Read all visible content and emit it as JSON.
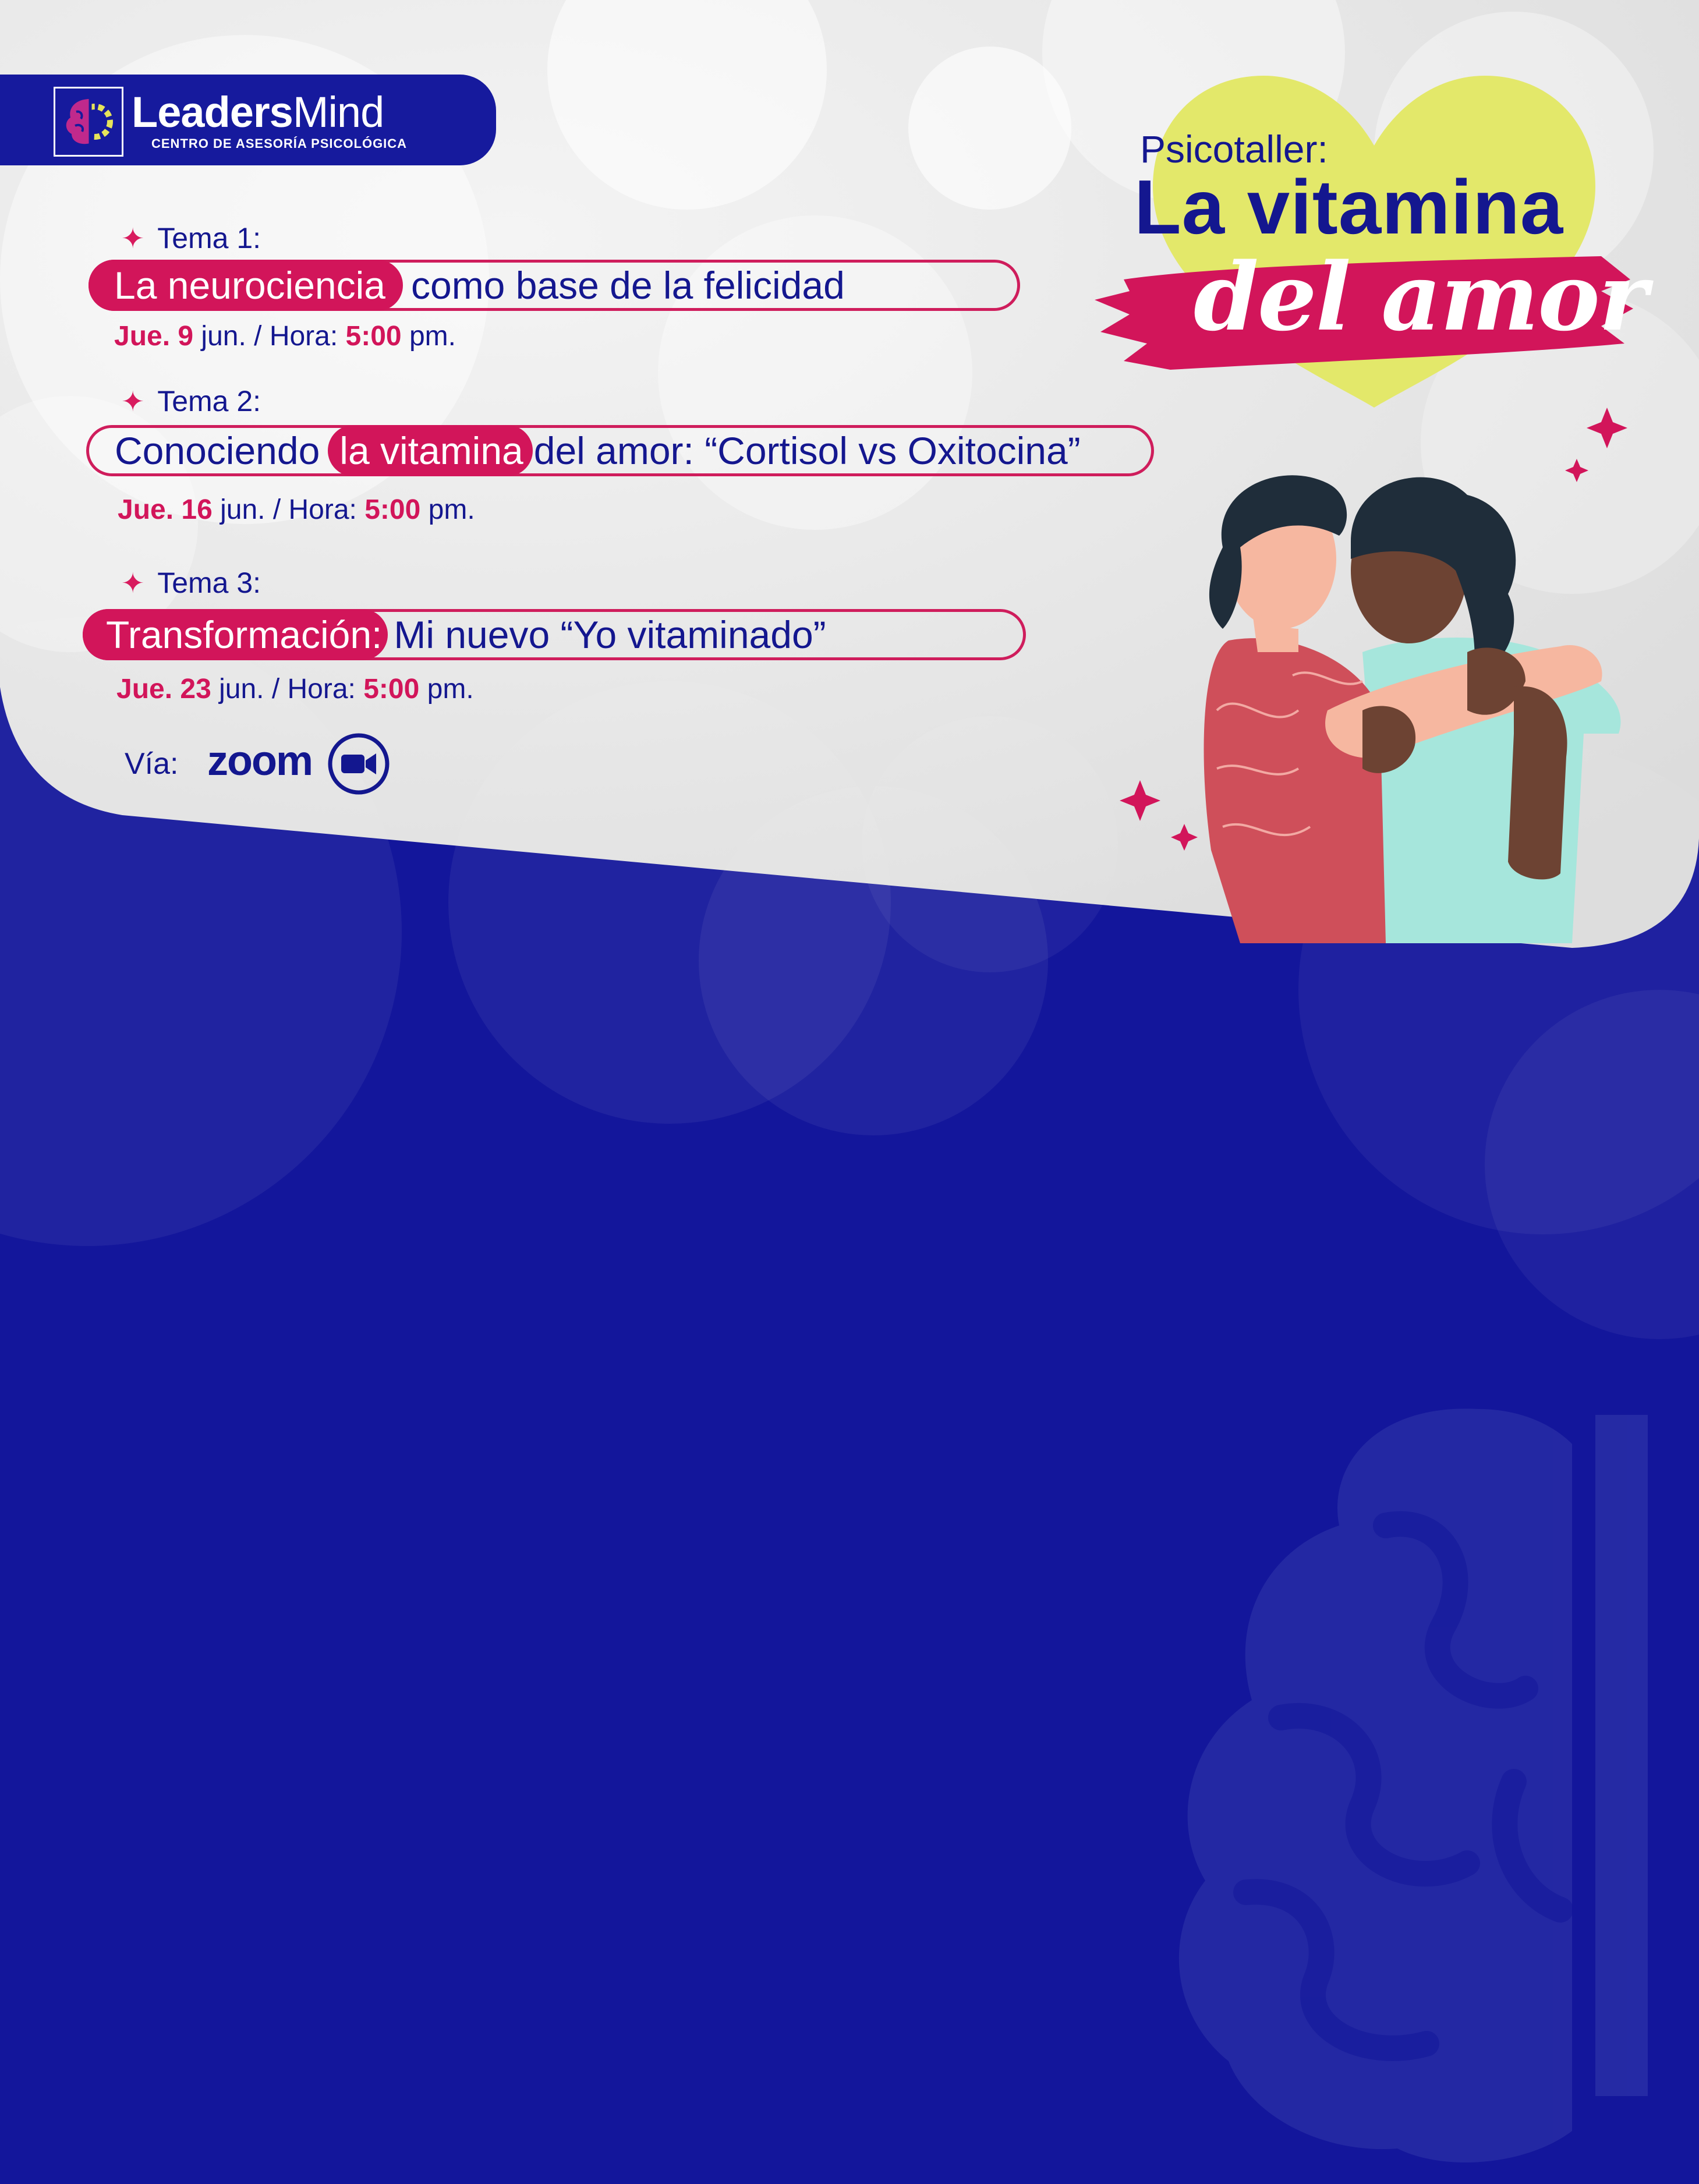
{
  "brand": {
    "name_bold": "Leaders",
    "name_light": "Mind",
    "subtitle": "CENTRO DE ASESORÍA PSICOLÓGICA"
  },
  "title": {
    "prefix": "Psicotaller:",
    "main": "La vitamina",
    "script": "del amor"
  },
  "topics": [
    {
      "label": "Tema 1:",
      "highlight": "La neurociencia",
      "rest": "como base de la felicidad",
      "day": "Jue. 9",
      "month": " jun. / Hora: ",
      "time": "5:00",
      "suffix": " pm."
    },
    {
      "label": "Tema 2:",
      "lead": "Conociendo",
      "highlight": "la vitamina",
      "rest": "del amor: “Cortisol vs Oxitocina”",
      "day": "Jue. 16",
      "month": " jun. / Hora: ",
      "time": "5:00",
      "suffix": " pm."
    },
    {
      "label": "Tema 3:",
      "highlight": "Transformación:",
      "rest": "Mi nuevo “Yo vitaminado”",
      "day": "Jue. 23",
      "month": " jun. / Hora: ",
      "time": "5:00",
      "suffix": " pm."
    }
  ],
  "via": {
    "label": "Vía:",
    "platform": "zoom",
    "icon": "video-camera-icon"
  },
  "colors": {
    "navy": "#13169b",
    "magenta": "#d2155a",
    "yellow": "#e3e86a",
    "panel": "#e6e6e6"
  }
}
